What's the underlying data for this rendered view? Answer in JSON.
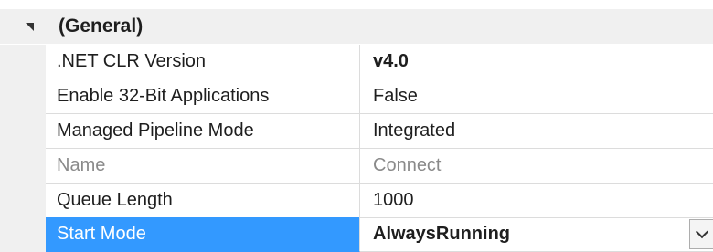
{
  "category": {
    "label": "(General)"
  },
  "properties": [
    {
      "name": ".NET CLR Version",
      "value": "v4.0"
    },
    {
      "name": "Enable 32-Bit Applications",
      "value": "False"
    },
    {
      "name": "Managed Pipeline Mode",
      "value": "Integrated"
    },
    {
      "name": "Name",
      "value": "Connect"
    },
    {
      "name": "Queue Length",
      "value": "1000"
    },
    {
      "name": "Start Mode",
      "value": "AlwaysRunning"
    }
  ],
  "colors": {
    "selection": "#3399ff",
    "gutter": "#f0f0f0",
    "disabled_text": "#8a8a8a"
  },
  "icons": {
    "expander": "collapse-triangle-icon",
    "dropdown": "chevron-down-icon"
  }
}
